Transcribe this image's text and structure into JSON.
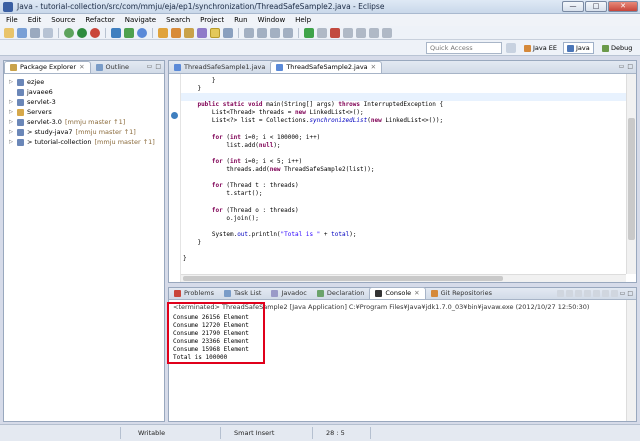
{
  "window": {
    "title": "Java - tutorial-collection/src/com/mmju/eja/ep1/synchronization/ThreadSafeSample2.java - Eclipse",
    "minimize": "—",
    "maximize": "□",
    "close": "✕"
  },
  "menu": [
    "File",
    "Edit",
    "Source",
    "Refactor",
    "Navigate",
    "Search",
    "Project",
    "Run",
    "Window",
    "Help"
  ],
  "search": {
    "placeholder": "Quick Access"
  },
  "perspectives": [
    {
      "label": "Java EE",
      "active": false
    },
    {
      "label": "Java",
      "active": true
    },
    {
      "label": "Debug",
      "active": false
    }
  ],
  "left_panel": {
    "tabs": [
      {
        "label": "Package Explorer",
        "active": true
      },
      {
        "label": "Outline",
        "active": false
      }
    ],
    "tree": [
      {
        "label": "ezjee",
        "decoration": ""
      },
      {
        "label": "javaee6",
        "decoration": ""
      },
      {
        "label": "servlet-3",
        "decoration": ""
      },
      {
        "label": "Servers",
        "decoration": ""
      },
      {
        "label": "servlet-3.0",
        "decoration": " [mmju master ↑1]"
      },
      {
        "label": "> study-java7",
        "decoration": " [mmju master ↑1]"
      },
      {
        "label": "> tutorial-collection",
        "decoration": " [mmju master ↑1]"
      }
    ]
  },
  "editor": {
    "tabs": [
      {
        "label": "ThreadSafeSample1.java",
        "active": false
      },
      {
        "label": "ThreadSafeSample2.java",
        "active": true
      }
    ],
    "lines": [
      [
        {
          "t": "        }",
          "c": ""
        }
      ],
      [
        {
          "t": "    }",
          "c": ""
        }
      ],
      [
        {
          "t": "",
          "c": ""
        }
      ],
      [
        {
          "t": "    ",
          "c": ""
        },
        {
          "t": "public static void",
          "c": "kw"
        },
        {
          "t": " main(String[] args) ",
          "c": ""
        },
        {
          "t": "throws",
          "c": "kw"
        },
        {
          "t": " InterruptedException {",
          "c": ""
        }
      ],
      [
        {
          "t": "        List<Thread> threads = ",
          "c": ""
        },
        {
          "t": "new",
          "c": "kw"
        },
        {
          "t": " LinkedList<>();",
          "c": ""
        }
      ],
      [
        {
          "t": "        List<?> list = Collections.",
          "c": ""
        },
        {
          "t": "synchronizedList",
          "c": "itl"
        },
        {
          "t": "(",
          "c": ""
        },
        {
          "t": "new",
          "c": "kw"
        },
        {
          "t": " LinkedList<>());",
          "c": ""
        }
      ],
      [
        {
          "t": "",
          "c": ""
        }
      ],
      [
        {
          "t": "        ",
          "c": ""
        },
        {
          "t": "for",
          "c": "kw"
        },
        {
          "t": " (",
          "c": ""
        },
        {
          "t": "int",
          "c": "kw"
        },
        {
          "t": " i=0; i < 100000; i++)",
          "c": ""
        }
      ],
      [
        {
          "t": "            list.add(",
          "c": ""
        },
        {
          "t": "null",
          "c": "kw"
        },
        {
          "t": ");",
          "c": ""
        }
      ],
      [
        {
          "t": "",
          "c": ""
        }
      ],
      [
        {
          "t": "        ",
          "c": ""
        },
        {
          "t": "for",
          "c": "kw"
        },
        {
          "t": " (",
          "c": ""
        },
        {
          "t": "int",
          "c": "kw"
        },
        {
          "t": " i=0; i < 5; i++)",
          "c": ""
        }
      ],
      [
        {
          "t": "            threads.add(",
          "c": ""
        },
        {
          "t": "new",
          "c": "kw"
        },
        {
          "t": " ThreadSafeSample2(list));",
          "c": ""
        }
      ],
      [
        {
          "t": "",
          "c": ""
        }
      ],
      [
        {
          "t": "        ",
          "c": ""
        },
        {
          "t": "for",
          "c": "kw"
        },
        {
          "t": " (Thread t : threads)",
          "c": ""
        }
      ],
      [
        {
          "t": "            t.start();",
          "c": ""
        }
      ],
      [
        {
          "t": "",
          "c": ""
        }
      ],
      [
        {
          "t": "        ",
          "c": ""
        },
        {
          "t": "for",
          "c": "kw"
        },
        {
          "t": " (Thread o : threads)",
          "c": ""
        }
      ],
      [
        {
          "t": "            o.join();",
          "c": ""
        }
      ],
      [
        {
          "t": "",
          "c": ""
        }
      ],
      [
        {
          "t": "        System.",
          "c": ""
        },
        {
          "t": "out",
          "c": "fld"
        },
        {
          "t": ".println(",
          "c": ""
        },
        {
          "t": "\"Total is \"",
          "c": "str"
        },
        {
          "t": " + ",
          "c": ""
        },
        {
          "t": "total",
          "c": "fld"
        },
        {
          "t": ");",
          "c": ""
        }
      ],
      [
        {
          "t": "    }",
          "c": ""
        }
      ],
      [
        {
          "t": "",
          "c": ""
        }
      ],
      [
        {
          "t": "}",
          "c": ""
        }
      ]
    ]
  },
  "bottom_panel": {
    "tabs": [
      {
        "label": "Problems",
        "active": false
      },
      {
        "label": "Task List",
        "active": false
      },
      {
        "label": "Javadoc",
        "active": false
      },
      {
        "label": "Declaration",
        "active": false
      },
      {
        "label": "Console",
        "active": true
      },
      {
        "label": "Git Repositories",
        "active": false
      }
    ],
    "terminated": "<terminated> ThreadSafeSample2 [Java Application] C:¥Program Files¥Java¥jdk1.7.0_03¥bin¥javaw.exe (2012/10/27 12:50:30)",
    "output": [
      "Consume 26156 Element",
      "Consume 12720 Element",
      "Consume 21790 Element",
      "Consume 23366 Element",
      "Consume 15968 Element",
      "Total is 100000"
    ]
  },
  "status": {
    "writable": "Writable",
    "insert_mode": "Smart Insert",
    "position": "28 : 5"
  },
  "colors": {
    "highlight_box": "#e0001b",
    "keyword": "#7f0055",
    "string": "#2a00ff"
  }
}
